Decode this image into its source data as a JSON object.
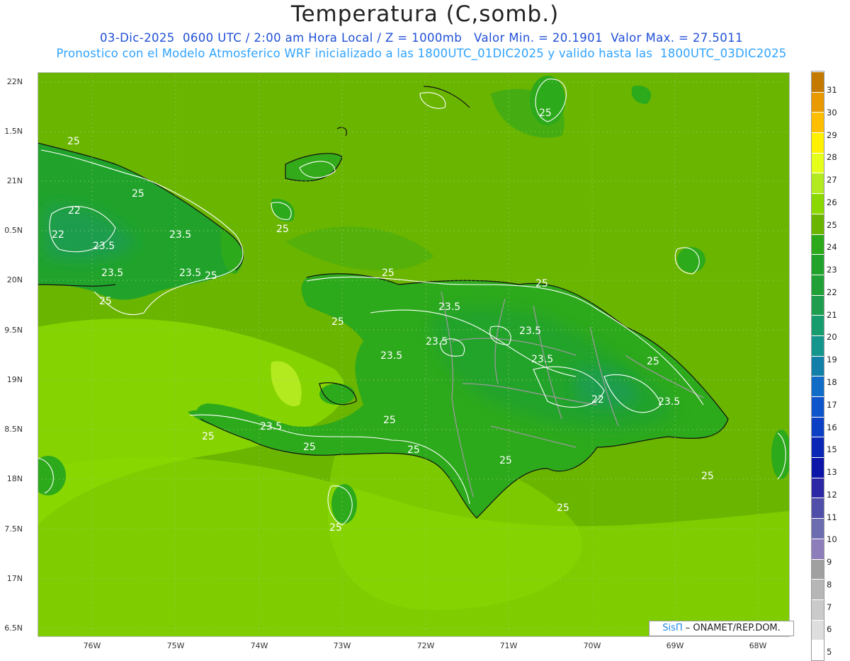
{
  "header": {
    "title": "Temperatura (C,somb.)",
    "line1": "03-Dic-2025  0600 UTC / 2:00 am Hora Local / Z = 1000mb   Valor Min. = 20.1901  Valor Max. = 27.5011",
    "line2": "Pronostico con el Modelo Atmosferico WRF inicializado a las 1800UTC_01DIC2025 y valido hasta las  1800UTC_03DIC2025"
  },
  "axes": {
    "lat_labels": [
      "22N",
      "1.5N",
      "21N",
      "0.5N",
      "20N",
      "9.5N",
      "19N",
      "8.5N",
      "18N",
      "7.5N",
      "17N",
      "6.5N"
    ],
    "lon_labels": [
      "76W",
      "75W",
      "74W",
      "73W",
      "72W",
      "71W",
      "70W",
      "69W",
      "68W"
    ]
  },
  "colorbar": {
    "labels": [
      "31",
      "30",
      "29",
      "28",
      "27",
      "26",
      "25",
      "24",
      "23",
      "22",
      "21",
      "20",
      "19",
      "18",
      "17",
      "16",
      "15",
      "13",
      "12",
      "11",
      "10",
      "9",
      "8",
      "7",
      "6",
      "5"
    ],
    "colors": [
      "#c47a00",
      "#e89a00",
      "#ffbf00",
      "#ffef00",
      "#e6ff1a",
      "#b2ea1f",
      "#8ad800",
      "#6ab500",
      "#2da91c",
      "#21a32b",
      "#21a036",
      "#1d9d4d",
      "#179c6e",
      "#15968d",
      "#127fa8",
      "#106cc6",
      "#0e55cc",
      "#0b3fc4",
      "#0a26b5",
      "#0d15a8",
      "#2b27a5",
      "#4f4fa9",
      "#6c6cb1",
      "#8d7ebb",
      "#a0a0a0",
      "#b6b6b6",
      "#cacaca",
      "#dedede",
      "#ffffff"
    ]
  },
  "contours": [
    "25",
    "25",
    "22",
    "22",
    "23.5",
    "23.5",
    "23.5",
    "23.5",
    "25",
    "25",
    "25",
    "25",
    "25",
    "25",
    "23.5",
    "23.5",
    "25",
    "23.5",
    "23.5",
    "23.5",
    "25",
    "22",
    "23.5",
    "25",
    "23.5",
    "25",
    "25",
    "25",
    "25",
    "25",
    "25",
    "25"
  ],
  "credit": {
    "brand": "SisΠ",
    "text": "– ONAMET/REP.DOM."
  }
}
